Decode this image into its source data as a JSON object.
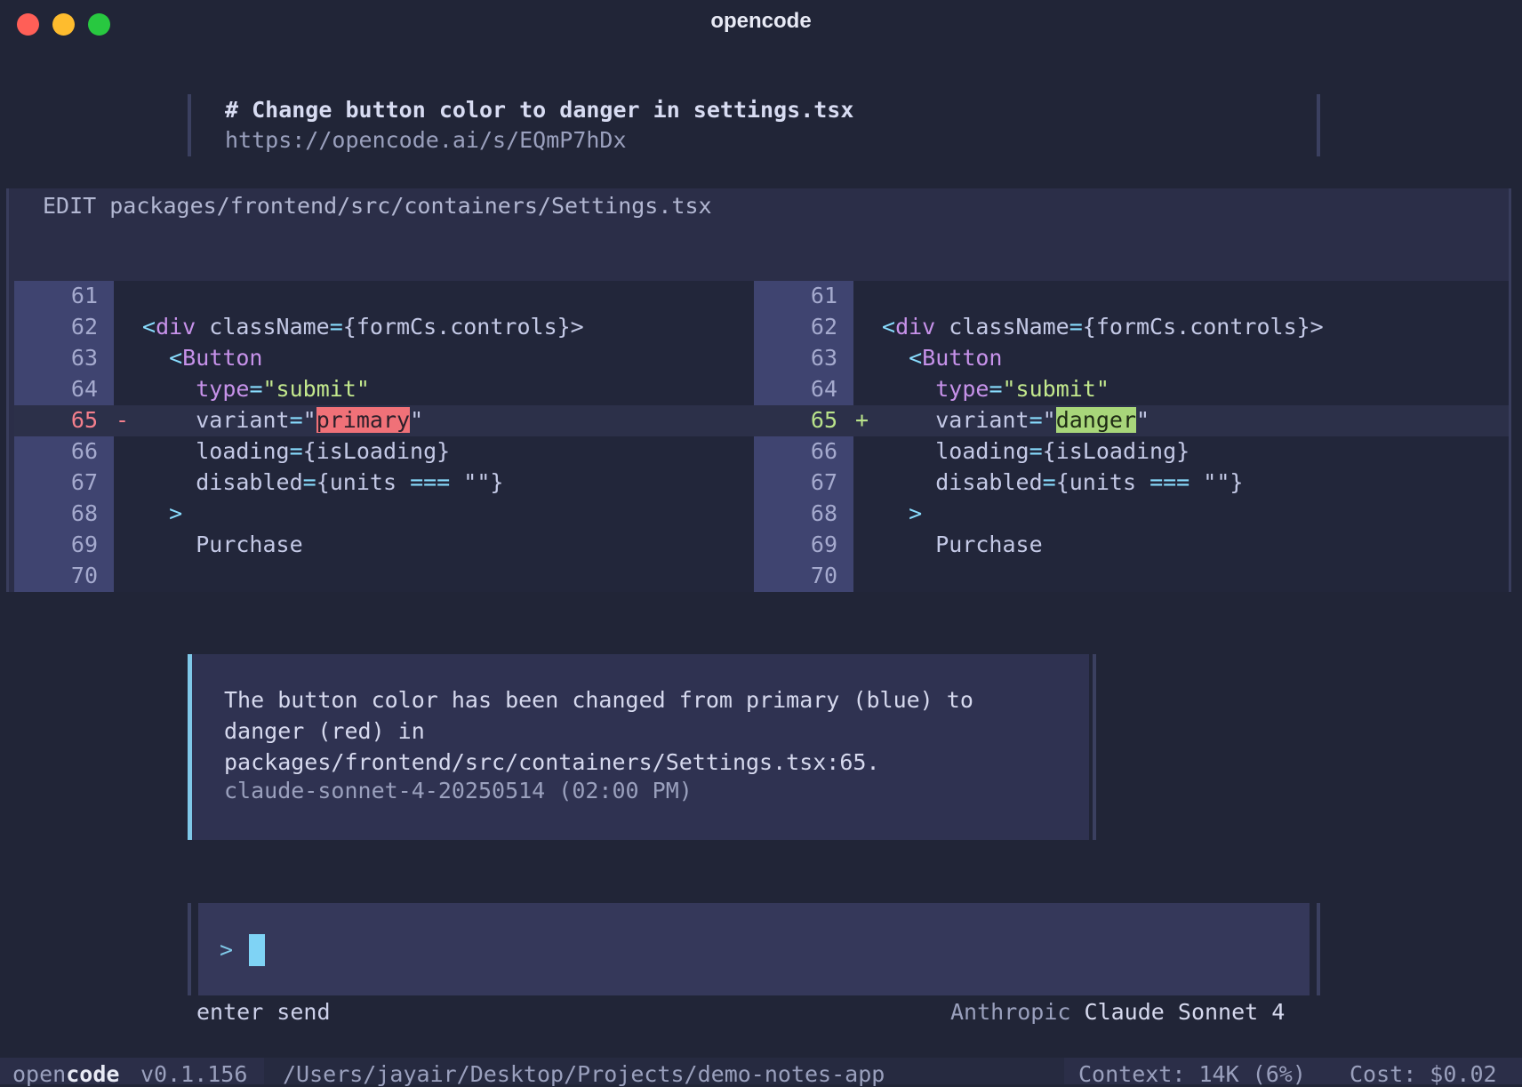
{
  "window": {
    "title": "opencode"
  },
  "user_message": {
    "heading": "# Change button color to danger in settings.tsx",
    "link": "https://opencode.ai/s/EQmP7hDx"
  },
  "edit": {
    "header": "EDIT packages/frontend/src/containers/Settings.tsx",
    "line_numbers": [
      "61",
      "62",
      "63",
      "64",
      "65",
      "66",
      "67",
      "68",
      "69",
      "70"
    ],
    "lines": {
      "l62": {
        "open": "<",
        "tag": "div",
        "attr": " className",
        "eq": "=",
        "val": "{formCs.controls}>"
      },
      "l63": {
        "open": "<",
        "tag": "Button"
      },
      "l64": {
        "attr": "type",
        "eq": "=",
        "val": "\"submit\""
      },
      "l65_left": {
        "mark": "-",
        "attr": "variant",
        "eq": "=",
        "q1": "\"",
        "val": "primary",
        "q2": "\""
      },
      "l65_right": {
        "mark": "+",
        "attr": "variant",
        "eq": "=",
        "q1": "\"",
        "val": "danger",
        "q2": "\""
      },
      "l66": {
        "attr": "loading",
        "eq": "=",
        "val": "{isLoading}"
      },
      "l67": {
        "attr": "disabled",
        "eq": "=",
        "val1": "{units ",
        "op": "===",
        "val2": " \"\"}"
      },
      "l68": {
        "close": ">"
      },
      "l69": {
        "text": "Purchase"
      }
    }
  },
  "assistant_message": {
    "line1": "The button color has been changed from primary (blue) to",
    "line2": "danger (red) in",
    "line3": "packages/frontend/src/containers/Settings.tsx:65.",
    "meta": "claude-sonnet-4-20250514 (02:00 PM)"
  },
  "input": {
    "prompt": ">",
    "hint": "enter send",
    "provider": "Anthropic",
    "model": "Claude Sonnet 4"
  },
  "status_bar": {
    "app_prefix": "open",
    "app_suffix": "code",
    "version": "v0.1.156",
    "path": "/Users/jayair/Desktop/Projects/demo-notes-app",
    "context": "Context: 14K (6%)",
    "cost": "Cost: $0.02"
  },
  "colors": {
    "background": "#212537",
    "deleted": "#f07178",
    "added": "#a8d67a",
    "accent": "#7fc8e8"
  }
}
